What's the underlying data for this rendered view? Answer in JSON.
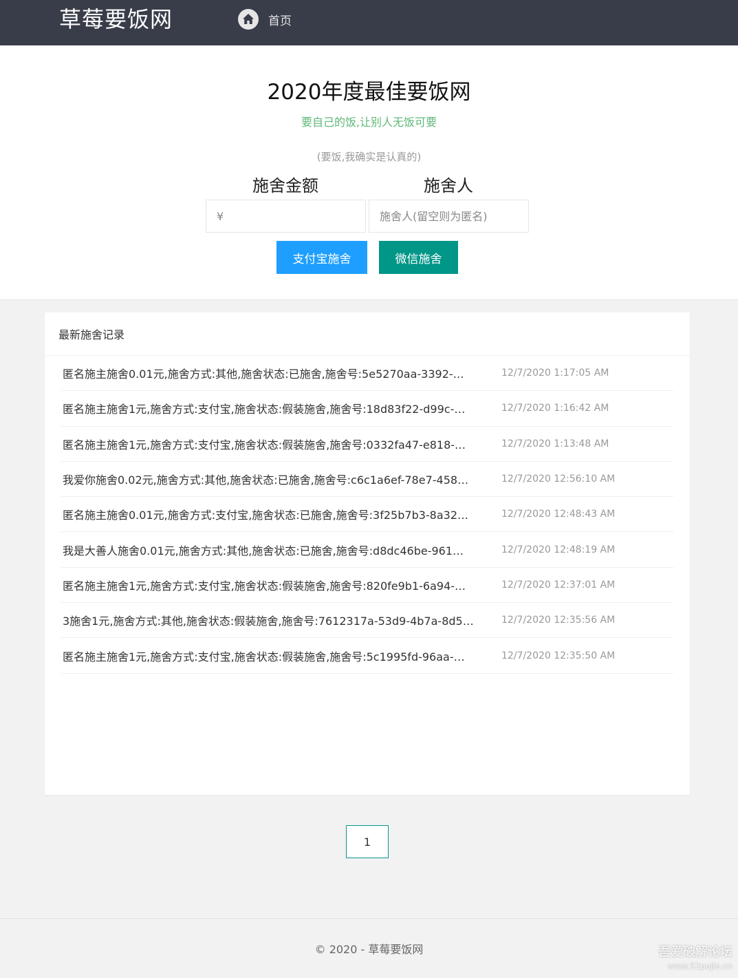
{
  "header": {
    "logo": "草莓要饭网",
    "nav_home_label": "首页",
    "nav_home_icon": "home-icon"
  },
  "hero": {
    "title": "2020年度最佳要饭网",
    "subtitle": "要自己的饭,让别人无饭可要",
    "note": "(要饭,我确实是认真的)",
    "amount_label": "施舍金额",
    "donor_label": "施舍人",
    "amount_placeholder": "¥",
    "donor_placeholder": "施舍人(留空则为匿名)",
    "alipay_button": "支付宝施舍",
    "wechat_button": "微信施舍"
  },
  "records": {
    "title": "最新施舍记录",
    "items": [
      {
        "text": "匿名施主施舍0.01元,施舍方式:其他,施舍状态:已施舍,施舍号:5e5270aa-3392-…",
        "time": "12/7/2020 1:17:05 AM"
      },
      {
        "text": "匿名施主施舍1元,施舍方式:支付宝,施舍状态:假装施舍,施舍号:18d83f22-d99c-…",
        "time": "12/7/2020 1:16:42 AM"
      },
      {
        "text": "匿名施主施舍1元,施舍方式:支付宝,施舍状态:假装施舍,施舍号:0332fa47-e818-…",
        "time": "12/7/2020 1:13:48 AM"
      },
      {
        "text": "我爱你施舍0.02元,施舍方式:其他,施舍状态:已施舍,施舍号:c6c1a6ef-78e7-458…",
        "time": "12/7/2020 12:56:10 AM"
      },
      {
        "text": "匿名施主施舍0.01元,施舍方式:支付宝,施舍状态:已施舍,施舍号:3f25b7b3-8a32…",
        "time": "12/7/2020 12:48:43 AM"
      },
      {
        "text": "我是大善人施舍0.01元,施舍方式:其他,施舍状态:已施舍,施舍号:d8dc46be-961…",
        "time": "12/7/2020 12:48:19 AM"
      },
      {
        "text": "匿名施主施舍1元,施舍方式:支付宝,施舍状态:假装施舍,施舍号:820fe9b1-6a94-…",
        "time": "12/7/2020 12:37:01 AM"
      },
      {
        "text": "3施舍1元,施舍方式:其他,施舍状态:假装施舍,施舍号:7612317a-53d9-4b7a-8d5…",
        "time": "12/7/2020 12:35:56 AM"
      },
      {
        "text": "匿名施主施舍1元,施舍方式:支付宝,施舍状态:假装施舍,施舍号:5c1995fd-96aa-…",
        "time": "12/7/2020 12:35:50 AM"
      }
    ]
  },
  "pagination": {
    "current_page": "1"
  },
  "footer": {
    "text": "© 2020 - 草莓要饭网"
  },
  "watermark": {
    "main": "吾爱破解论坛",
    "url": "www.52pojie.cn"
  },
  "colors": {
    "topbar": "#393d49",
    "subtitle_green": "#5fb878",
    "alipay_blue": "#1e9fff",
    "wechat_teal": "#009688"
  }
}
